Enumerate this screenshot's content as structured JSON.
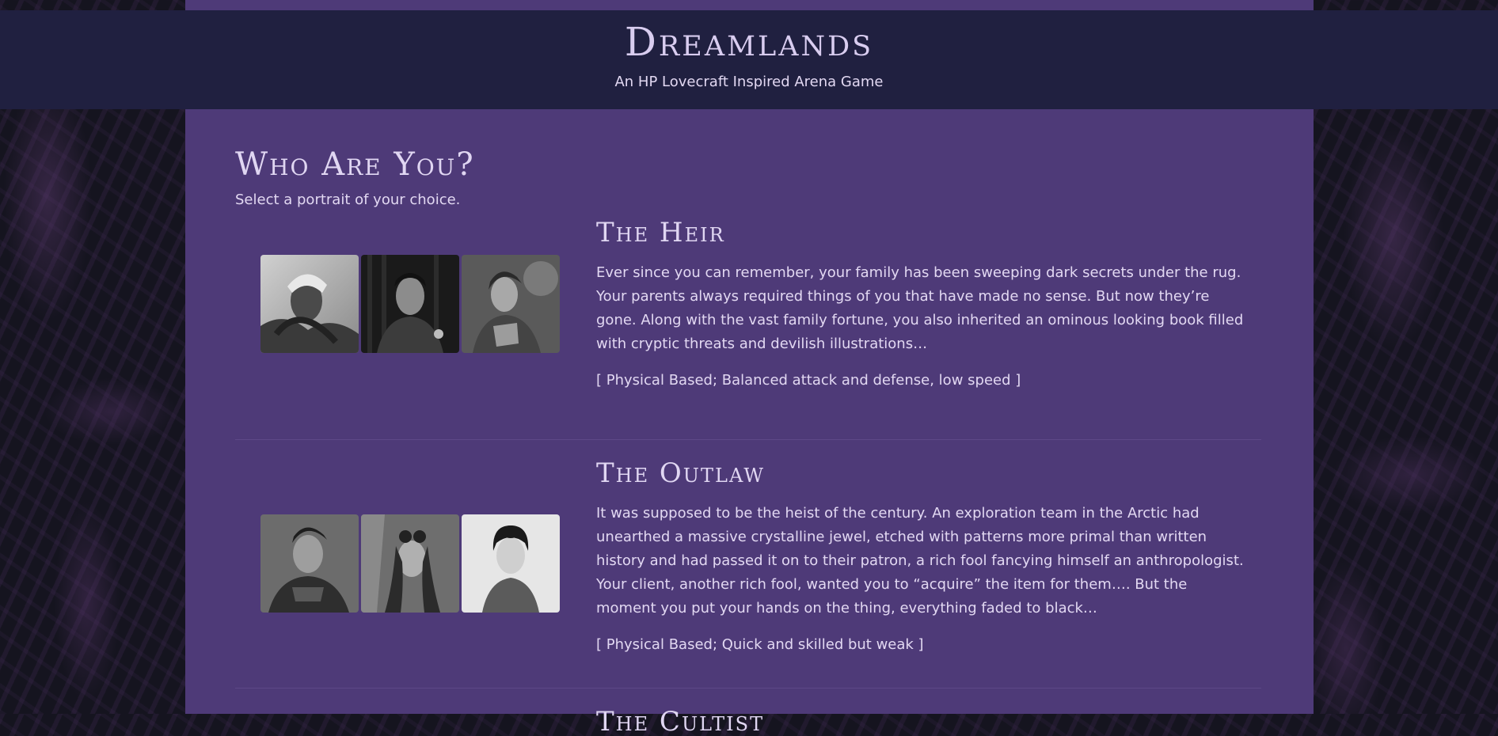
{
  "header": {
    "title": "Dreamlands",
    "subtitle": "An HP Lovecraft Inspired Arena Game"
  },
  "section": {
    "title": "Who Are You?",
    "intro": "Select a portrait of your choice."
  },
  "characters": [
    {
      "name": "The Heir",
      "description": "Ever since you can remember, your family has been sweeping dark secrets under the rug. Your parents always required things of you that have made no sense. But now they’re gone. Along with the vast family fortune, you also inherited an ominous looking book filled with cryptic threats and devilish illustrations…",
      "stats": "[ Physical Based; Balanced attack and defense, low speed ]"
    },
    {
      "name": "The Outlaw",
      "description": "It was supposed to be the heist of the century. An exploration team in the Arctic had unearthed a massive crystalline jewel, etched with patterns more primal than written history and had passed it on to their patron, a rich fool fancying himself an anthropologist. Your client, another rich fool, wanted you to “acquire” the item for them…. But the moment you put your hands on the thing, everything faded to black…",
      "stats": "[ Physical Based; Quick and skilled but weak ]"
    },
    {
      "name": "The Cultist"
    }
  ],
  "colors": {
    "panel": "#4e3a78",
    "header": "#202040",
    "text": "#e2d8f2"
  }
}
